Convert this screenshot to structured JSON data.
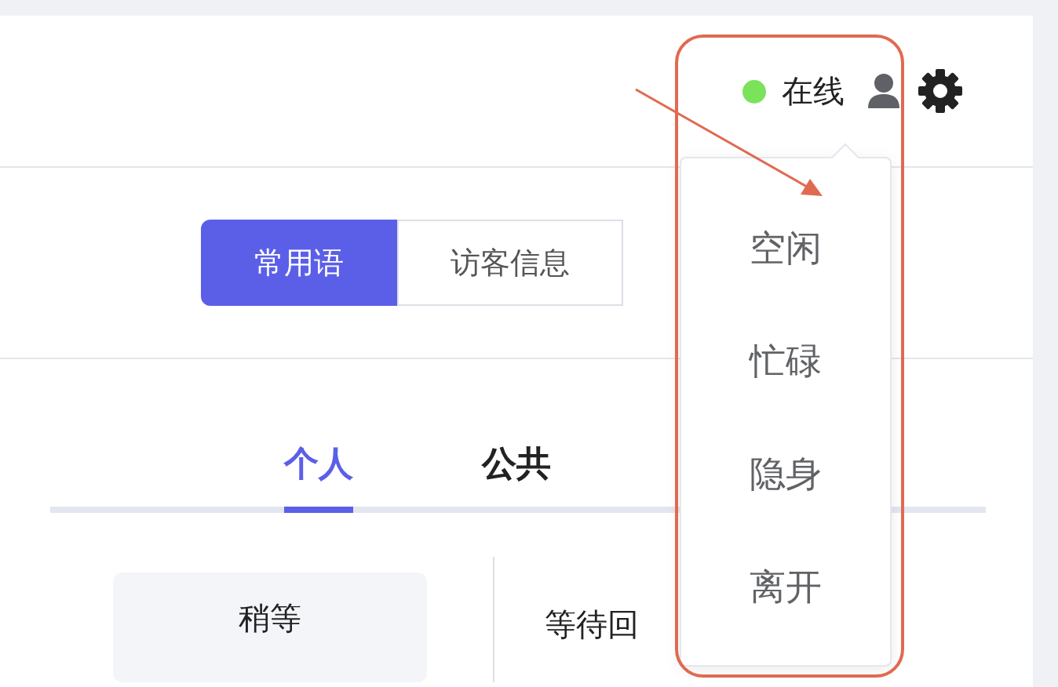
{
  "header": {
    "status": {
      "label": "在线",
      "online": true
    }
  },
  "segments": [
    {
      "label": "常用语",
      "selected": true
    },
    {
      "label": "访客信息",
      "selected": false
    }
  ],
  "tabs": [
    {
      "label": "个人",
      "selected": true
    },
    {
      "label": "公共",
      "selected": false
    }
  ],
  "phrases": [
    {
      "title": "稍等",
      "text": "等待回"
    }
  ],
  "status_menu": {
    "items": [
      "空闲",
      "忙碌",
      "隐身",
      "离开"
    ]
  }
}
